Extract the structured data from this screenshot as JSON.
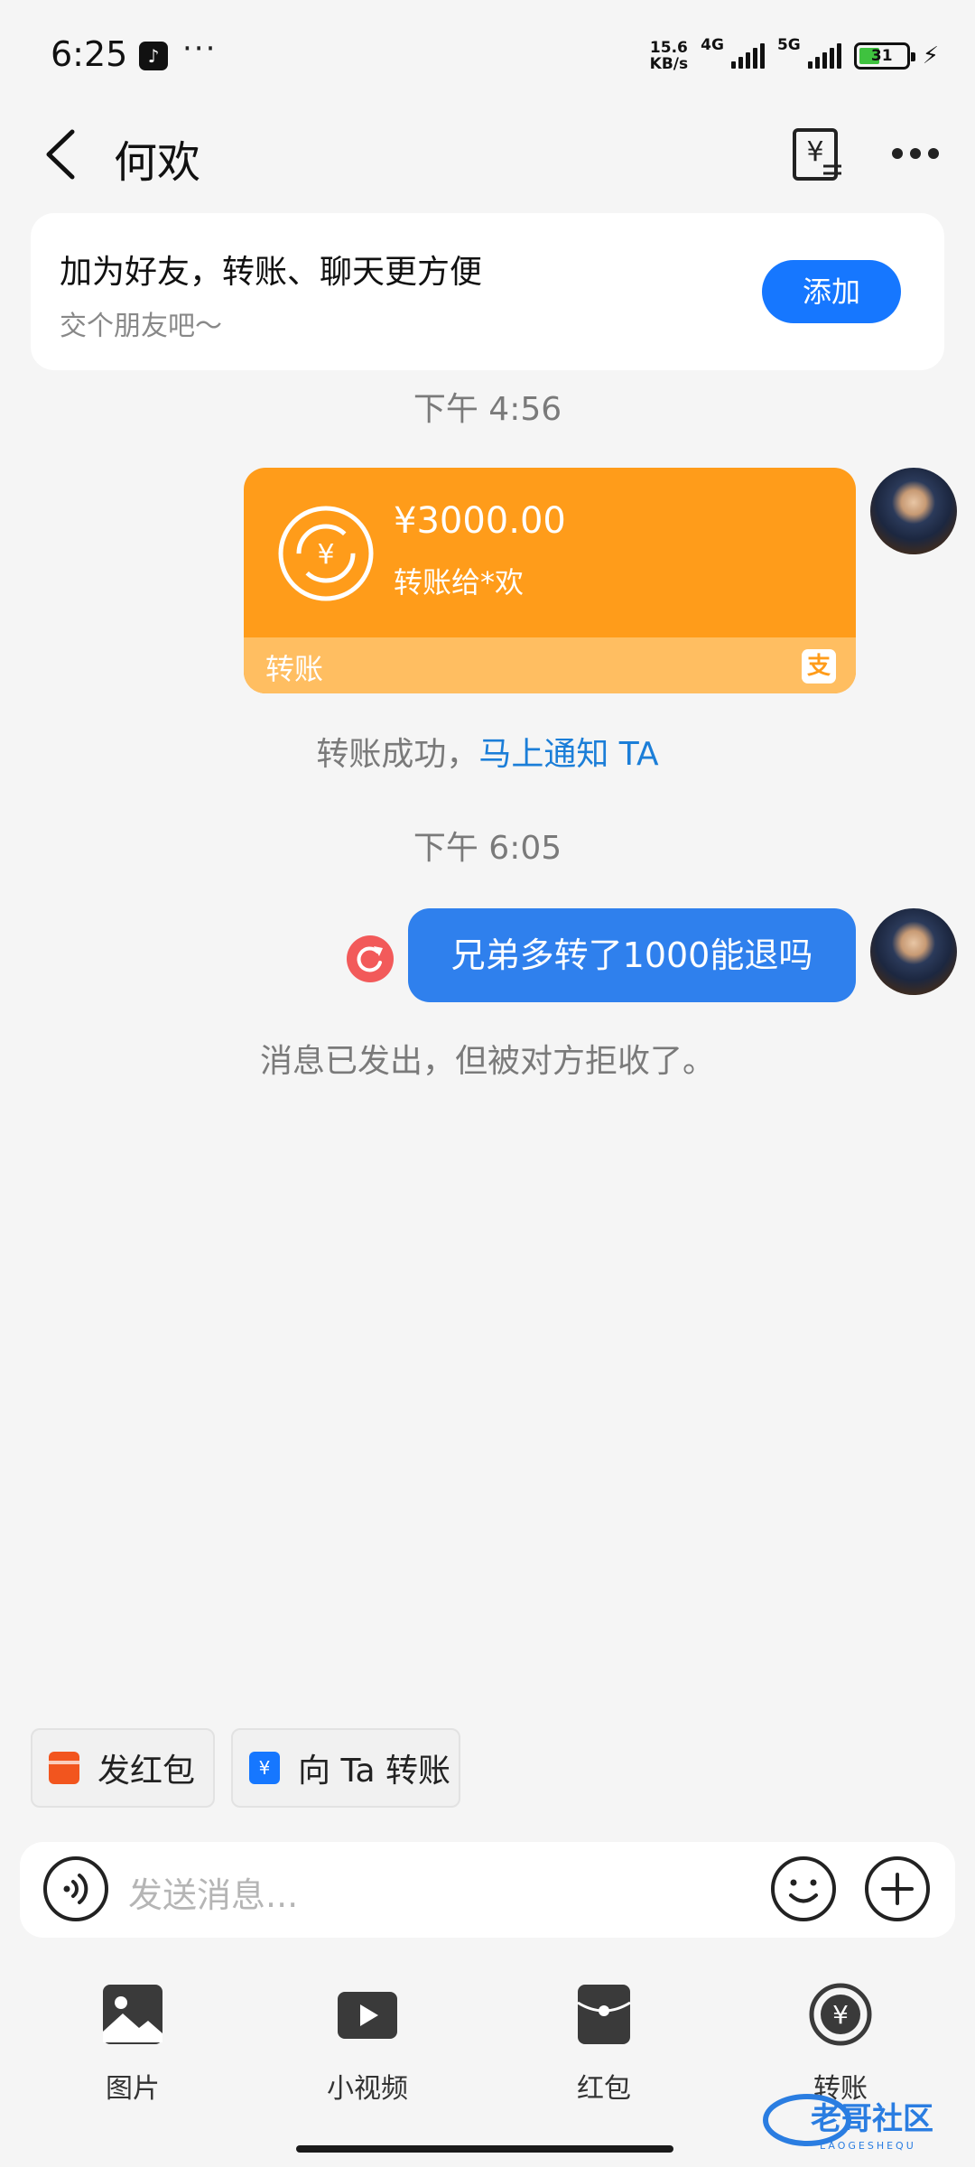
{
  "status_bar": {
    "time": "6:25",
    "more_dots": "···",
    "net_speed_value": "15.6",
    "net_speed_unit": "KB/s",
    "net_4g": "4G",
    "net_5g": "5G",
    "battery": "31"
  },
  "header": {
    "title": "何欢"
  },
  "friend_card": {
    "title": "加为好友，转账、聊天更方便",
    "subtitle": "交个朋友吧～",
    "add_label": "添加"
  },
  "chat": {
    "timestamp_1": "下午 4:56",
    "transfer": {
      "amount": "¥3000.00",
      "to": "转账给*欢",
      "label": "转账",
      "alipay_glyph": "支"
    },
    "notice_text": "转账成功，",
    "notice_link": "马上通知 TA",
    "timestamp_2": "下午 6:05",
    "message": "兄弟多转了1000能退吗",
    "rejected": "消息已发出，但被对方拒收了。"
  },
  "quick_actions": {
    "red_packet": "发红包",
    "transfer_to_ta": "向 Ta 转账"
  },
  "input": {
    "placeholder": "发送消息..."
  },
  "panel": {
    "items": [
      {
        "label": "图片",
        "icon": "image-icon"
      },
      {
        "label": "小视频",
        "icon": "video-icon"
      },
      {
        "label": "红包",
        "icon": "red-packet-icon"
      },
      {
        "label": "转账",
        "icon": "transfer-icon"
      }
    ]
  },
  "watermark": {
    "text": "老哥社区",
    "sub": "LAOGESHEQU"
  },
  "colors": {
    "accent": "#1677ff",
    "transfer_orange": "#ff9c1a",
    "message_blue": "#2f80ed",
    "link": "#1b7ed8",
    "resend_red": "#f25a5a"
  }
}
